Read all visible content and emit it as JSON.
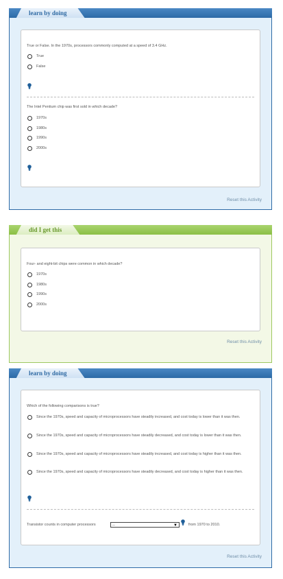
{
  "activity1": {
    "tab_label": "learn by doing",
    "q1": {
      "text": "True or False. In the 1970s, processors commonly computed at a speed of 3.4 GHz.",
      "options": [
        "True",
        "False"
      ]
    },
    "q2": {
      "text": "The Intel Pentium chip was first sold in which decade?",
      "options": [
        "1970s",
        "1980s",
        "1990s",
        "2000s"
      ]
    },
    "reset_label": "Reset this Activity"
  },
  "activity2": {
    "tab_label": "did I get this",
    "q1": {
      "text": "Four- and eight-bit chips were common in which decade?",
      "options": [
        "1970s",
        "1980s",
        "1990s",
        "2000s"
      ]
    },
    "reset_label": "Reset this Activity"
  },
  "activity3": {
    "tab_label": "learn by doing",
    "q1": {
      "text": "Which of the following comparisons is true?",
      "options": [
        "Since the 1970s, speed and capacity of microprocessors have steadily increased, and cost today is lower than it was then.",
        "Since the 1970s, speed and capacity of microprocessors have steadily decreased, and cost today is lower than it was then.",
        "Since the 1970s, speed and capacity of microprocessors have steadily increased, and cost today is higher than it was then.",
        "Since the 1970s, speed and capacity of microprocessors have steadily decreased, and cost today is higher than it was then."
      ]
    },
    "q2": {
      "prefix": "Transistor counts in computer processors",
      "select_value": "--",
      "suffix": "from 1970 to 2010."
    },
    "reset_label": "Reset this Activity"
  },
  "colors": {
    "blue_accent": "#2d6aa6",
    "blue_panel": "#e3f0fa",
    "green_accent": "#8bbf45",
    "green_panel": "#f3f8e6",
    "hint_icon": "#1f5f99"
  },
  "icons": {
    "hint": "lightbulb-icon",
    "select": "chevron-down-icon"
  }
}
